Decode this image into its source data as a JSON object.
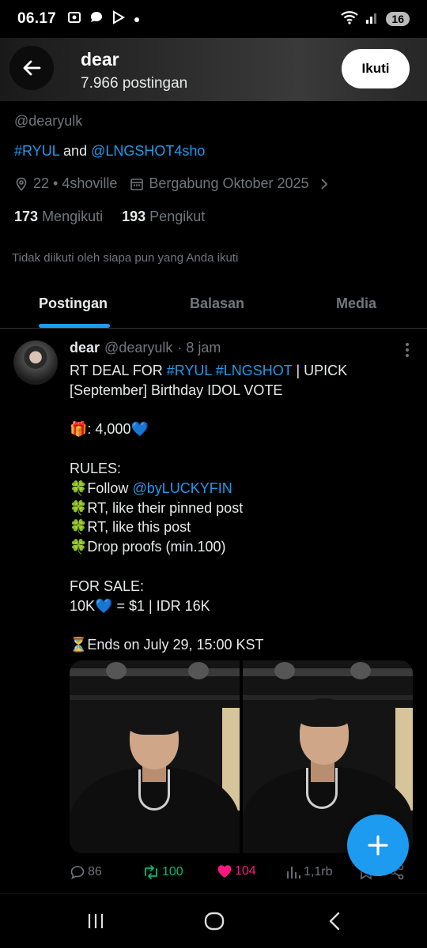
{
  "status_bar": {
    "time": "06.17",
    "battery": "16",
    "left_icons": [
      "screenshot-icon",
      "chat-icon",
      "play-icon",
      "dot-icon"
    ],
    "right_icons": [
      "wifi-icon",
      "signal-icon"
    ]
  },
  "header": {
    "name": "dear",
    "post_count": "7.966 postingan",
    "follow_label": "Ikuti"
  },
  "profile": {
    "handle": "@dearyulk",
    "bio_parts": {
      "tag1": "#RYUL",
      "and": " and ",
      "mention": "@LNGSHOT4sho"
    },
    "location": "22 • 4shoville",
    "joined": "Bergabung Oktober 2025",
    "following_count": "173",
    "following_label": "Mengikuti",
    "followers_count": "193",
    "followers_label": "Pengikut",
    "not_followed_text": "Tidak diikuti oleh siapa pun yang Anda ikuti"
  },
  "tabs": [
    {
      "label": "Postingan",
      "active": true
    },
    {
      "label": "Balasan",
      "active": false
    },
    {
      "label": "Media",
      "active": false
    }
  ],
  "post": {
    "author": "dear",
    "handle": "@dearyulk",
    "time": "· 8 jam",
    "line1_prefix": "RT DEAL FOR ",
    "line1_tag1": "#RYUL",
    "line1_tag2": "#LNGSHOT",
    "line1_suffix": " | UPICK",
    "line2": "[September] Birthday IDOL VOTE",
    "prize": "🎁: 4,000💙",
    "rules_title": "RULES:",
    "rule1_prefix": "🍀Follow ",
    "rule1_mention": "@byLUCKYFIN",
    "rule2": "🍀RT, like their pinned post",
    "rule3": "🍀RT, like this post",
    "rule4": "🍀Drop proofs (min.100)",
    "sale_title": "FOR SALE:",
    "sale_text": "10K💙 = $1 | IDR 16K",
    "ends": "⏳Ends on July 29, 15:00 KST",
    "replies": "86",
    "reposts": "100",
    "likes": "104",
    "views": "1,1rb"
  },
  "colors": {
    "accent": "#1d9bf0",
    "repost": "#00ba7c",
    "like": "#f91880",
    "muted": "#71767b",
    "text": "#e7e9ea",
    "background": "#000000"
  },
  "navbar": {
    "buttons": [
      "recent-apps-icon",
      "home-icon",
      "back-nav-icon"
    ]
  }
}
